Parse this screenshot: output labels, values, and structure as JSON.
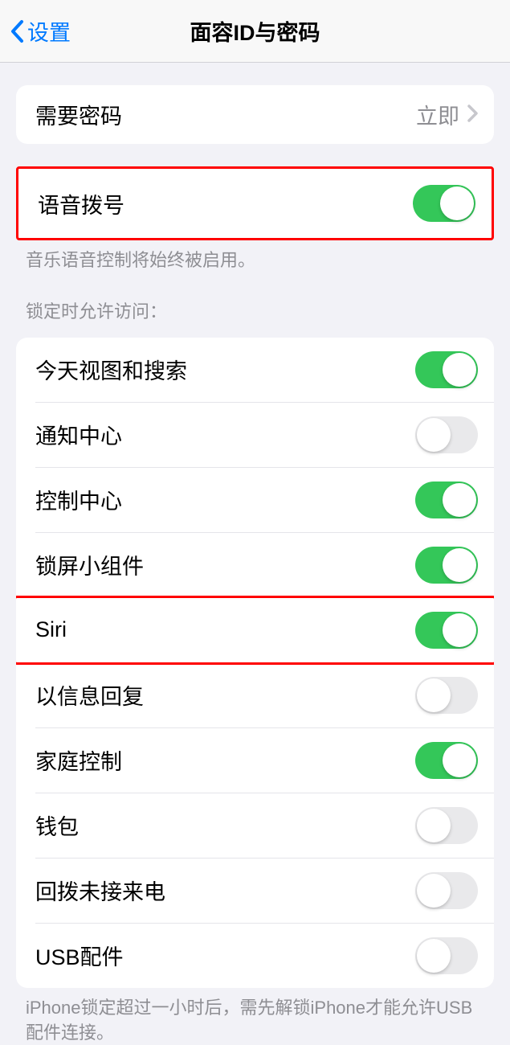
{
  "header": {
    "back_label": "设置",
    "title": "面容ID与密码"
  },
  "require_passcode": {
    "label": "需要密码",
    "value": "立即"
  },
  "voice_dial": {
    "label": "语音拨号",
    "footer": "音乐语音控制将始终被启用。"
  },
  "access_section": {
    "header": "锁定时允许访问：",
    "items": [
      {
        "label": "今天视图和搜索",
        "on": true
      },
      {
        "label": "通知中心",
        "on": false
      },
      {
        "label": "控制中心",
        "on": true
      },
      {
        "label": "锁屏小组件",
        "on": true
      },
      {
        "label": "Siri",
        "on": true
      },
      {
        "label": "以信息回复",
        "on": false
      },
      {
        "label": "家庭控制",
        "on": true
      },
      {
        "label": "钱包",
        "on": false
      },
      {
        "label": "回拨未接来电",
        "on": false
      },
      {
        "label": "USB配件",
        "on": false
      }
    ],
    "footer": "iPhone锁定超过一小时后，需先解锁iPhone才能允许USB配件连接。"
  }
}
